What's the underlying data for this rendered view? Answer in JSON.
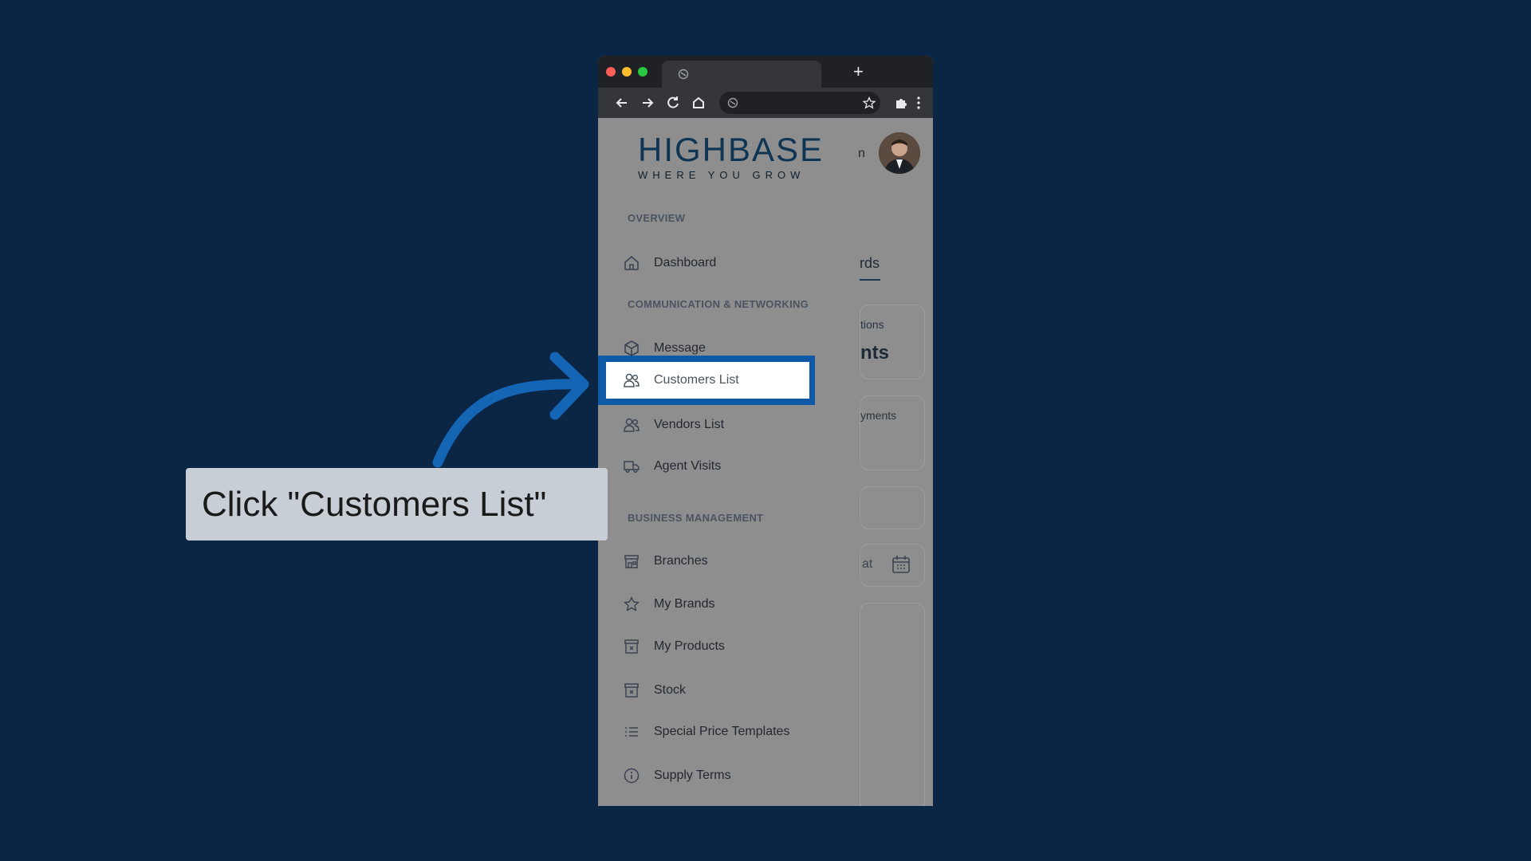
{
  "browser": {
    "new_tab_symbol": "+"
  },
  "app": {
    "logo_main": "HIGHBASE",
    "logo_sub": "WHERE YOU GROW",
    "user_partial": "n",
    "sidebar": {
      "sections": [
        {
          "label": "OVERVIEW"
        },
        {
          "label": "COMMUNICATION & NETWORKING"
        },
        {
          "label": "BUSINESS MANAGEMENT"
        }
      ],
      "items": [
        {
          "label": "Dashboard",
          "icon": "home-icon"
        },
        {
          "label": "Message",
          "icon": "box-icon"
        },
        {
          "label": "Customers List",
          "icon": "users-icon",
          "highlighted": true
        },
        {
          "label": "Vendors List",
          "icon": "users-icon"
        },
        {
          "label": "Agent Visits",
          "icon": "truck-icon"
        },
        {
          "label": "Branches",
          "icon": "store-icon"
        },
        {
          "label": "My Brands",
          "icon": "star-icon"
        },
        {
          "label": "My Products",
          "icon": "archive-icon"
        },
        {
          "label": "Stock",
          "icon": "archive-icon"
        },
        {
          "label": "Special Price Templates",
          "icon": "list-icon"
        },
        {
          "label": "Supply Terms",
          "icon": "info-icon"
        }
      ]
    },
    "background_partial": {
      "tab_text": "rds",
      "card1_label": "tions",
      "card1_value": "nts",
      "card2_label": "yments",
      "date_text": "at"
    }
  },
  "callout": {
    "text": "Click \"Customers List\""
  },
  "colors": {
    "background": "#0b2545",
    "highlight": "#0e5aa7",
    "arrow": "#1565b5"
  }
}
